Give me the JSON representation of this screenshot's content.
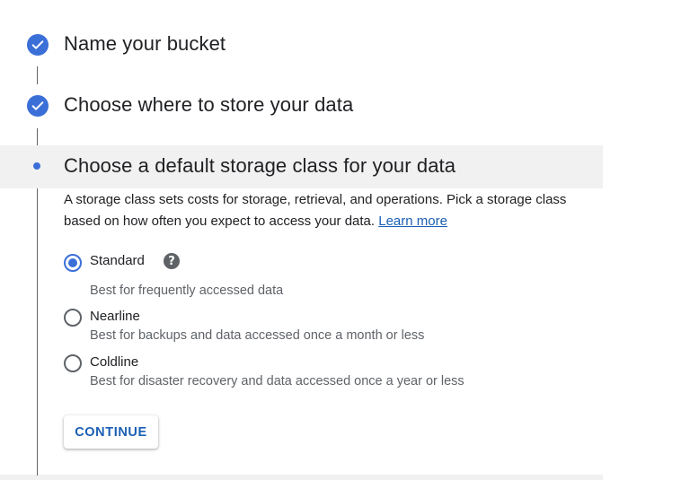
{
  "steps": [
    {
      "title": "Name your bucket",
      "state": "done"
    },
    {
      "title": "Choose where to store your data",
      "state": "done"
    },
    {
      "title": "Choose a default storage class for your data",
      "state": "active"
    }
  ],
  "storage_class": {
    "description": "A storage class sets costs for storage, retrieval, and operations. Pick a storage class based on how often you expect to access your data.",
    "learn_more": "Learn more",
    "options": [
      {
        "label": "Standard",
        "sublabel": "Best for frequently accessed data",
        "selected": true,
        "help_icon": "help-icon"
      },
      {
        "label": "Nearline",
        "sublabel": "Best for backups and data accessed once a month or less",
        "selected": false
      },
      {
        "label": "Coldline",
        "sublabel": "Best for disaster recovery and data accessed once a year or less",
        "selected": false
      }
    ],
    "continue_label": "CONTINUE"
  },
  "colors": {
    "accent": "#3b6fd8",
    "link": "#1a5fb4",
    "text": "#202124",
    "secondary_text": "#5f6368",
    "active_band": "#f1f1f1"
  }
}
